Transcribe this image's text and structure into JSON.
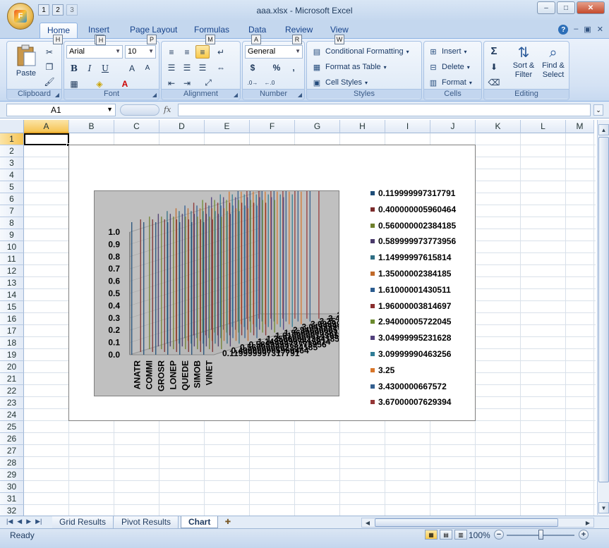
{
  "window": {
    "title": "aaa.xlsx - Microsoft Excel",
    "qat_keytips": [
      "1",
      "2",
      "3"
    ],
    "minimize": "–",
    "restore": "□",
    "close": "✕"
  },
  "ribbon_tabs": [
    {
      "label": "Home",
      "keytip": "H",
      "active": true
    },
    {
      "label": "Insert",
      "keytip": "N"
    },
    {
      "label": "Page Layout",
      "keytip": "P"
    },
    {
      "label": "Formulas",
      "keytip": "M"
    },
    {
      "label": "Data",
      "keytip": "A"
    },
    {
      "label": "Review",
      "keytip": "R"
    },
    {
      "label": "View",
      "keytip": "W"
    }
  ],
  "ribbon": {
    "clipboard": {
      "label": "Clipboard",
      "paste": "Paste"
    },
    "font": {
      "label": "Font",
      "name": "Arial",
      "size": "10",
      "bold": "B",
      "italic": "I",
      "underline": "U",
      "grow": "A",
      "shrink": "A"
    },
    "alignment": {
      "label": "Alignment"
    },
    "number": {
      "label": "Number",
      "format": "General",
      "currency": "$",
      "percent": "%",
      "comma": ","
    },
    "styles": {
      "label": "Styles",
      "conditional": "Conditional Formatting",
      "format_table": "Format as Table",
      "cell_styles": "Cell Styles"
    },
    "cells": {
      "label": "Cells",
      "insert": "Insert",
      "delete": "Delete",
      "format": "Format"
    },
    "editing": {
      "label": "Editing",
      "sort": "Sort &",
      "sort2": "Filter",
      "find": "Find &",
      "find2": "Select"
    }
  },
  "formula_bar": {
    "cell_ref": "A1",
    "fx": "fx",
    "value": ""
  },
  "columns": [
    "A",
    "B",
    "C",
    "D",
    "E",
    "F",
    "G",
    "H",
    "I",
    "J",
    "K",
    "L",
    "M"
  ],
  "rows": [
    "1",
    "2",
    "3",
    "4",
    "5",
    "6",
    "7",
    "8",
    "9",
    "10",
    "11",
    "12",
    "13",
    "14",
    "15",
    "16",
    "17",
    "18",
    "19",
    "20",
    "21",
    "22",
    "23",
    "24",
    "25",
    "26",
    "27",
    "28",
    "29",
    "30",
    "31",
    "32"
  ],
  "chart_data": {
    "type": "bar",
    "subtype": "3d-column",
    "categories": [
      "ANATR",
      "COMMI",
      "GROSR",
      "LONEP",
      "QUEDE",
      "SIMOB",
      "VINET"
    ],
    "y_ticks": [
      "0.0",
      "0.1",
      "0.2",
      "0.3",
      "0.4",
      "0.5",
      "0.6",
      "0.7",
      "0.8",
      "0.9",
      "1.0"
    ],
    "ylim": [
      0,
      1
    ],
    "grid": true,
    "legend_position": "right",
    "series": [
      {
        "name": "0.119999997317791",
        "color": "#1f4e79"
      },
      {
        "name": "0.400000005960464",
        "color": "#7b2b2b"
      },
      {
        "name": "0.560000002384185",
        "color": "#6e7f2b"
      },
      {
        "name": "0.589999973773956",
        "color": "#4a3a6b"
      },
      {
        "name": "1.14999997615814",
        "color": "#2e6e84"
      },
      {
        "name": "1.35000002384185",
        "color": "#c06a2a"
      },
      {
        "name": "1.61000001430511",
        "color": "#2b5c8f"
      },
      {
        "name": "1.96000003814697",
        "color": "#8a2e2e"
      },
      {
        "name": "2.94000005722045",
        "color": "#6b8a2e"
      },
      {
        "name": "3.04999995231628",
        "color": "#52407d"
      },
      {
        "name": "3.09999990463256",
        "color": "#2f7d96"
      },
      {
        "name": "3.25",
        "color": "#d8762a"
      },
      {
        "name": "3.4300000667572",
        "color": "#335f8f"
      },
      {
        "name": "3.67000007629394",
        "color": "#953636"
      }
    ]
  },
  "sheet_tabs": [
    "Grid Results",
    "Pivot Results",
    "Chart"
  ],
  "active_sheet": "Chart",
  "status": {
    "mode": "Ready",
    "zoom": "100%"
  }
}
